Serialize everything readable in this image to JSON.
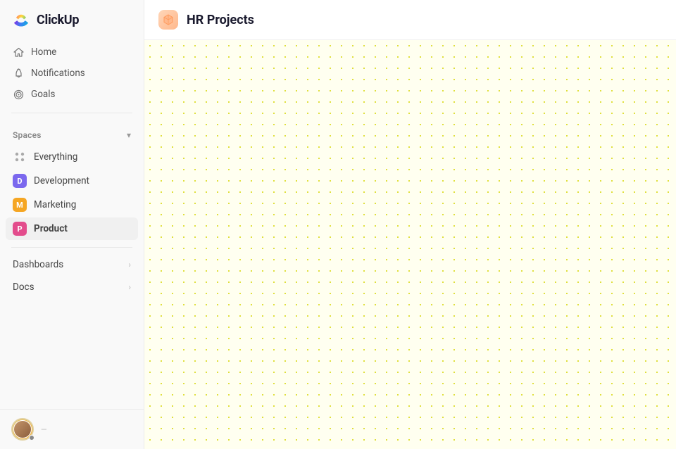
{
  "app": {
    "name": "ClickUp"
  },
  "sidebar": {
    "logo_text": "ClickUp",
    "nav_items": [
      {
        "id": "home",
        "label": "Home",
        "icon": "home"
      },
      {
        "id": "notifications",
        "label": "Notifications",
        "icon": "bell"
      },
      {
        "id": "goals",
        "label": "Goals",
        "icon": "target"
      }
    ],
    "spaces_section": {
      "label": "Spaces",
      "chevron": "▾"
    },
    "spaces": [
      {
        "id": "everything",
        "label": "Everything",
        "type": "grid"
      },
      {
        "id": "development",
        "label": "Development",
        "type": "letter",
        "letter": "D",
        "color": "#7b68ee"
      },
      {
        "id": "marketing",
        "label": "Marketing",
        "type": "letter",
        "letter": "M",
        "color": "#f5a623"
      },
      {
        "id": "product",
        "label": "Product",
        "type": "letter",
        "letter": "P",
        "color": "#e34c8c",
        "active": true
      }
    ],
    "expandable_items": [
      {
        "id": "dashboards",
        "label": "Dashboards"
      },
      {
        "id": "docs",
        "label": "Docs"
      }
    ]
  },
  "main": {
    "page_title": "HR Projects",
    "page_icon": "📦"
  }
}
